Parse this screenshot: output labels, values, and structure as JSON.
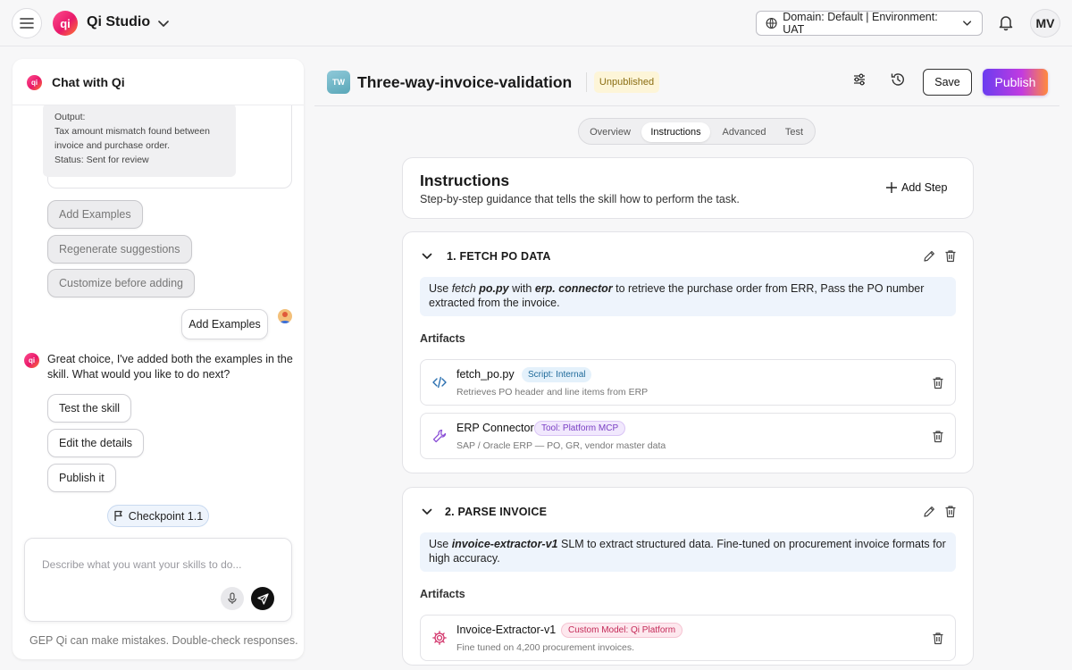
{
  "app": {
    "title": "Qi Studio",
    "logo_text": "qi"
  },
  "header": {
    "domain_env": "Domain: Default | Environment: UAT",
    "avatar_initials": "MV"
  },
  "chat": {
    "title": "Chat with Qi",
    "output_lines": [
      "Output:",
      "Tax amount mismatch found between",
      "invoice and purchase order.",
      "Status: Sent for review"
    ],
    "suggestions": [
      "Add Examples",
      "Regenerate suggestions",
      "Customize before adding"
    ],
    "user_message": "Add Examples",
    "bot_message": "Great choice, I've added both the examples in the skill. What would you like to do next?",
    "actions": [
      "Test the skill",
      "Edit the details",
      "Publish it"
    ],
    "checkpoint": "Checkpoint 1.1",
    "input_placeholder": "Describe what you want your skills to do...",
    "disclaimer": "GEP Qi can make mistakes. Double-check responses."
  },
  "skill": {
    "initials": "TW",
    "title": "Three-way-invoice-validation",
    "status": "Unpublished",
    "save_label": "Save",
    "publish_label": "Publish",
    "tabs": [
      "Overview",
      "Instructions",
      "Advanced",
      "Test"
    ],
    "active_tab": "Instructions"
  },
  "instructions": {
    "title": "Instructions",
    "subtitle": "Step-by-step guidance that tells the skill how to perform the task.",
    "add_step_label": "Add Step",
    "artifacts_label": "Artifacts",
    "steps": [
      {
        "title": "1. FETCH PO DATA",
        "desc_parts": [
          "Use ",
          "fetch ",
          "po.py",
          " with ",
          "erp. connector",
          " to retrieve the purchase order from ERR, Pass the PO number extracted from the invoice."
        ],
        "artifacts": [
          {
            "name": "fetch_po.py",
            "tag": "Script: Internal",
            "desc": "Retrieves PO header and line items from ERP",
            "icon": "code-icon"
          },
          {
            "name": "ERP Connector",
            "tag": "Tool: Platform MCP",
            "desc": "SAP / Oracle ERP — PO, GR, vendor master data",
            "icon": "wrench-icon"
          }
        ]
      },
      {
        "title": "2. PARSE INVOICE",
        "desc_parts": [
          "Use ",
          "invoice-extractor-v1",
          " SLM to extract structured data. Fine-tuned on procurement invoice formats for high accuracy."
        ],
        "artifacts": [
          {
            "name": "Invoice-Extractor-v1",
            "tag": "Custom Model: Qi Platform",
            "desc": "Fine tuned on 4,200 procurement invoices.",
            "icon": "gear-icon"
          }
        ]
      }
    ]
  },
  "colors": {
    "accent": "#e8196b",
    "publish_start": "#6a3cf0",
    "publish_end": "#ff8a3d",
    "step_desc_bg": "#eef4fc"
  }
}
